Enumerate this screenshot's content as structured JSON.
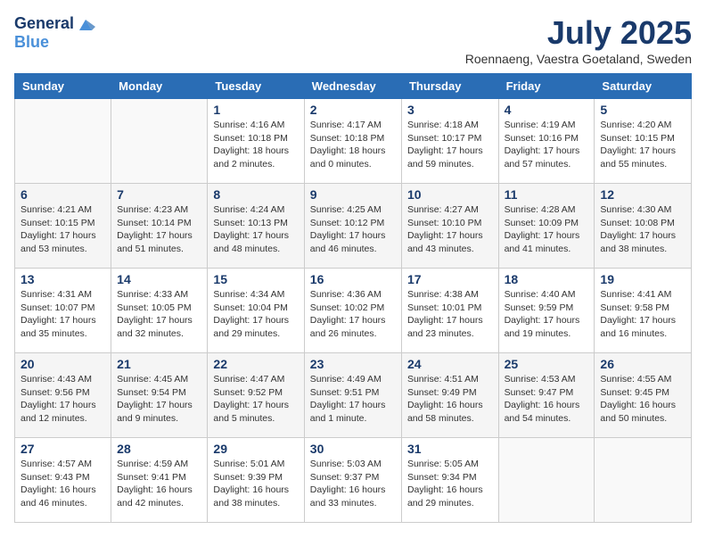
{
  "logo": {
    "line1": "General",
    "line2": "Blue"
  },
  "title": "July 2025",
  "location": "Roennaeng, Vaestra Goetaland, Sweden",
  "weekdays": [
    "Sunday",
    "Monday",
    "Tuesday",
    "Wednesday",
    "Thursday",
    "Friday",
    "Saturday"
  ],
  "weeks": [
    [
      {
        "day": "",
        "sunrise": "",
        "sunset": "",
        "daylight": ""
      },
      {
        "day": "",
        "sunrise": "",
        "sunset": "",
        "daylight": ""
      },
      {
        "day": "1",
        "sunrise": "Sunrise: 4:16 AM",
        "sunset": "Sunset: 10:18 PM",
        "daylight": "Daylight: 18 hours and 2 minutes."
      },
      {
        "day": "2",
        "sunrise": "Sunrise: 4:17 AM",
        "sunset": "Sunset: 10:18 PM",
        "daylight": "Daylight: 18 hours and 0 minutes."
      },
      {
        "day": "3",
        "sunrise": "Sunrise: 4:18 AM",
        "sunset": "Sunset: 10:17 PM",
        "daylight": "Daylight: 17 hours and 59 minutes."
      },
      {
        "day": "4",
        "sunrise": "Sunrise: 4:19 AM",
        "sunset": "Sunset: 10:16 PM",
        "daylight": "Daylight: 17 hours and 57 minutes."
      },
      {
        "day": "5",
        "sunrise": "Sunrise: 4:20 AM",
        "sunset": "Sunset: 10:15 PM",
        "daylight": "Daylight: 17 hours and 55 minutes."
      }
    ],
    [
      {
        "day": "6",
        "sunrise": "Sunrise: 4:21 AM",
        "sunset": "Sunset: 10:15 PM",
        "daylight": "Daylight: 17 hours and 53 minutes."
      },
      {
        "day": "7",
        "sunrise": "Sunrise: 4:23 AM",
        "sunset": "Sunset: 10:14 PM",
        "daylight": "Daylight: 17 hours and 51 minutes."
      },
      {
        "day": "8",
        "sunrise": "Sunrise: 4:24 AM",
        "sunset": "Sunset: 10:13 PM",
        "daylight": "Daylight: 17 hours and 48 minutes."
      },
      {
        "day": "9",
        "sunrise": "Sunrise: 4:25 AM",
        "sunset": "Sunset: 10:12 PM",
        "daylight": "Daylight: 17 hours and 46 minutes."
      },
      {
        "day": "10",
        "sunrise": "Sunrise: 4:27 AM",
        "sunset": "Sunset: 10:10 PM",
        "daylight": "Daylight: 17 hours and 43 minutes."
      },
      {
        "day": "11",
        "sunrise": "Sunrise: 4:28 AM",
        "sunset": "Sunset: 10:09 PM",
        "daylight": "Daylight: 17 hours and 41 minutes."
      },
      {
        "day": "12",
        "sunrise": "Sunrise: 4:30 AM",
        "sunset": "Sunset: 10:08 PM",
        "daylight": "Daylight: 17 hours and 38 minutes."
      }
    ],
    [
      {
        "day": "13",
        "sunrise": "Sunrise: 4:31 AM",
        "sunset": "Sunset: 10:07 PM",
        "daylight": "Daylight: 17 hours and 35 minutes."
      },
      {
        "day": "14",
        "sunrise": "Sunrise: 4:33 AM",
        "sunset": "Sunset: 10:05 PM",
        "daylight": "Daylight: 17 hours and 32 minutes."
      },
      {
        "day": "15",
        "sunrise": "Sunrise: 4:34 AM",
        "sunset": "Sunset: 10:04 PM",
        "daylight": "Daylight: 17 hours and 29 minutes."
      },
      {
        "day": "16",
        "sunrise": "Sunrise: 4:36 AM",
        "sunset": "Sunset: 10:02 PM",
        "daylight": "Daylight: 17 hours and 26 minutes."
      },
      {
        "day": "17",
        "sunrise": "Sunrise: 4:38 AM",
        "sunset": "Sunset: 10:01 PM",
        "daylight": "Daylight: 17 hours and 23 minutes."
      },
      {
        "day": "18",
        "sunrise": "Sunrise: 4:40 AM",
        "sunset": "Sunset: 9:59 PM",
        "daylight": "Daylight: 17 hours and 19 minutes."
      },
      {
        "day": "19",
        "sunrise": "Sunrise: 4:41 AM",
        "sunset": "Sunset: 9:58 PM",
        "daylight": "Daylight: 17 hours and 16 minutes."
      }
    ],
    [
      {
        "day": "20",
        "sunrise": "Sunrise: 4:43 AM",
        "sunset": "Sunset: 9:56 PM",
        "daylight": "Daylight: 17 hours and 12 minutes."
      },
      {
        "day": "21",
        "sunrise": "Sunrise: 4:45 AM",
        "sunset": "Sunset: 9:54 PM",
        "daylight": "Daylight: 17 hours and 9 minutes."
      },
      {
        "day": "22",
        "sunrise": "Sunrise: 4:47 AM",
        "sunset": "Sunset: 9:52 PM",
        "daylight": "Daylight: 17 hours and 5 minutes."
      },
      {
        "day": "23",
        "sunrise": "Sunrise: 4:49 AM",
        "sunset": "Sunset: 9:51 PM",
        "daylight": "Daylight: 17 hours and 1 minute."
      },
      {
        "day": "24",
        "sunrise": "Sunrise: 4:51 AM",
        "sunset": "Sunset: 9:49 PM",
        "daylight": "Daylight: 16 hours and 58 minutes."
      },
      {
        "day": "25",
        "sunrise": "Sunrise: 4:53 AM",
        "sunset": "Sunset: 9:47 PM",
        "daylight": "Daylight: 16 hours and 54 minutes."
      },
      {
        "day": "26",
        "sunrise": "Sunrise: 4:55 AM",
        "sunset": "Sunset: 9:45 PM",
        "daylight": "Daylight: 16 hours and 50 minutes."
      }
    ],
    [
      {
        "day": "27",
        "sunrise": "Sunrise: 4:57 AM",
        "sunset": "Sunset: 9:43 PM",
        "daylight": "Daylight: 16 hours and 46 minutes."
      },
      {
        "day": "28",
        "sunrise": "Sunrise: 4:59 AM",
        "sunset": "Sunset: 9:41 PM",
        "daylight": "Daylight: 16 hours and 42 minutes."
      },
      {
        "day": "29",
        "sunrise": "Sunrise: 5:01 AM",
        "sunset": "Sunset: 9:39 PM",
        "daylight": "Daylight: 16 hours and 38 minutes."
      },
      {
        "day": "30",
        "sunrise": "Sunrise: 5:03 AM",
        "sunset": "Sunset: 9:37 PM",
        "daylight": "Daylight: 16 hours and 33 minutes."
      },
      {
        "day": "31",
        "sunrise": "Sunrise: 5:05 AM",
        "sunset": "Sunset: 9:34 PM",
        "daylight": "Daylight: 16 hours and 29 minutes."
      },
      {
        "day": "",
        "sunrise": "",
        "sunset": "",
        "daylight": ""
      },
      {
        "day": "",
        "sunrise": "",
        "sunset": "",
        "daylight": ""
      }
    ]
  ]
}
